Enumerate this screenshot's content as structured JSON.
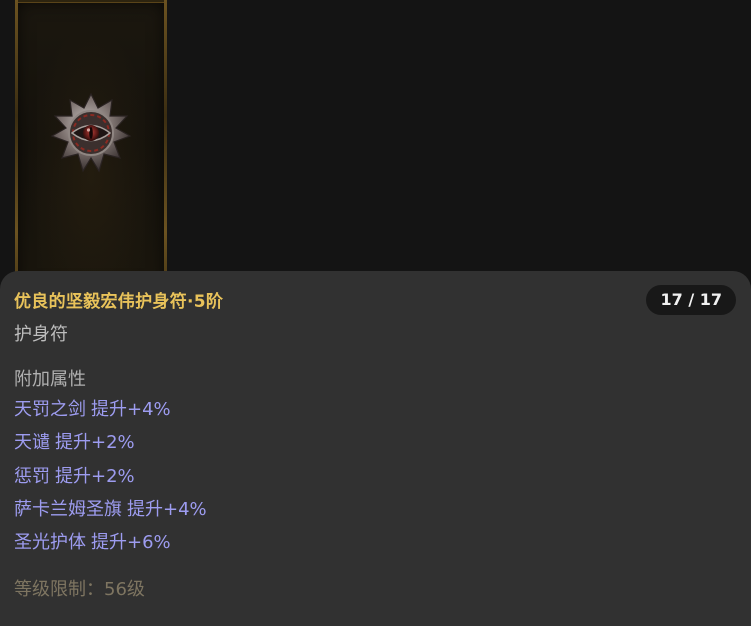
{
  "item": {
    "name": "优良的坚毅宏伟护身符·5阶",
    "type": "护身符",
    "counter": "17 / 17",
    "icon": "amulet-icon",
    "section_title": "附加属性",
    "attributes": [
      {
        "skill": "天罚之剑",
        "bonus": "提升+4%"
      },
      {
        "skill": "天谴",
        "bonus": "提升+2%"
      },
      {
        "skill": "惩罚",
        "bonus": "提升+2%"
      },
      {
        "skill": "萨卡兰姆圣旗",
        "bonus": "提升+4%"
      },
      {
        "skill": "圣光护体",
        "bonus": "提升+6%"
      }
    ],
    "level_requirement": "等级限制：56级"
  },
  "colors": {
    "name": "#e8c25a",
    "attribute": "#9d9cf0",
    "requirement": "#7e7561",
    "panel": "#313131",
    "background": "#141414"
  }
}
